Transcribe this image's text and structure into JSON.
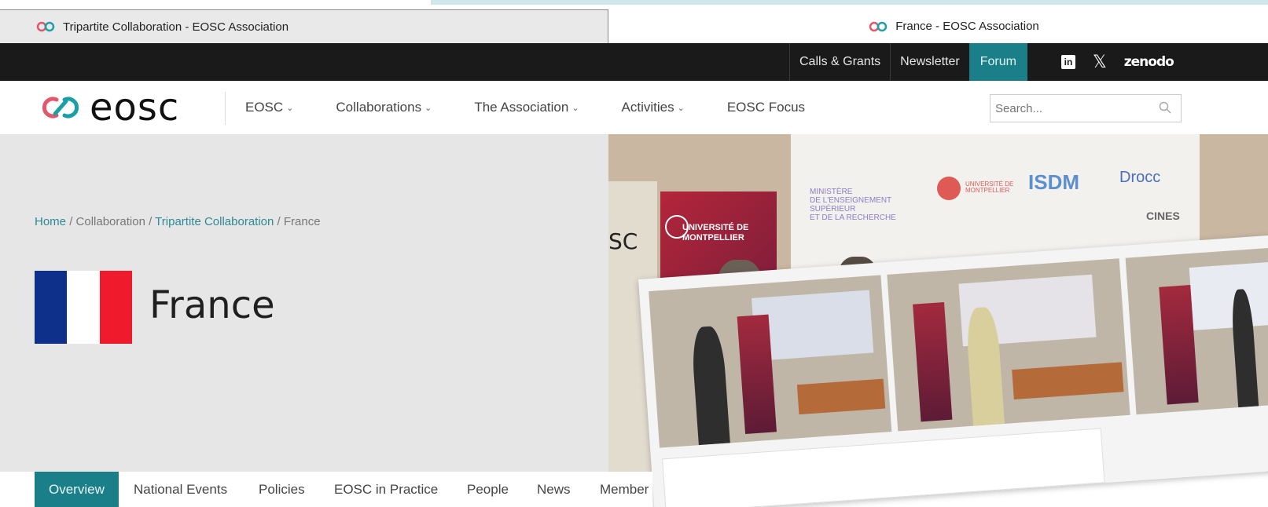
{
  "browser": {
    "tab_left_title": "Tripartite Collaboration - EOSC Association",
    "tab_right_title": "France - EOSC Association"
  },
  "utility_bar": {
    "links": [
      "Calls & Grants",
      "Newsletter",
      "Forum"
    ],
    "active": "Forum",
    "social": {
      "linkedin": "in",
      "x": "𝕏",
      "zenodo": "zenodo"
    }
  },
  "nav": {
    "logo_text": "eosc",
    "items": [
      "EOSC",
      "Collaborations",
      "The Association",
      "Activities",
      "EOSC Focus"
    ],
    "search_placeholder": "Search..."
  },
  "hero": {
    "breadcrumb": [
      {
        "label": "Home",
        "link": true
      },
      {
        "label": "Collaboration",
        "link": false
      },
      {
        "label": "Tripartite Collaboration",
        "link": true
      },
      {
        "label": "France",
        "link": false
      }
    ],
    "country": "France",
    "flag_colors": [
      "#0e2f8a",
      "#ffffff",
      "#ef1b2d"
    ]
  },
  "subtabs": {
    "items": [
      "Overview",
      "National Events",
      "Policies",
      "EOSC in Practice",
      "People",
      "News",
      "Member"
    ],
    "active": "Overview"
  },
  "photo": {
    "screen_text": [
      "MINISTÈRE",
      "DE L'ENSEIGNEMENT",
      "SUPÉRIEUR",
      "ET DE LA RECHERCHE"
    ],
    "logos": [
      "ISDM",
      "Drocc",
      "CINES"
    ],
    "univ_banner": [
      "UNIVERSITÉ DE",
      "MONTPELLIER"
    ],
    "sc_text": "SC"
  },
  "colors": {
    "accent": "#1b7f8a",
    "utility_bg": "#1a1a1a",
    "hero_bg": "#e6e6e6",
    "link": "#2b8a96"
  }
}
